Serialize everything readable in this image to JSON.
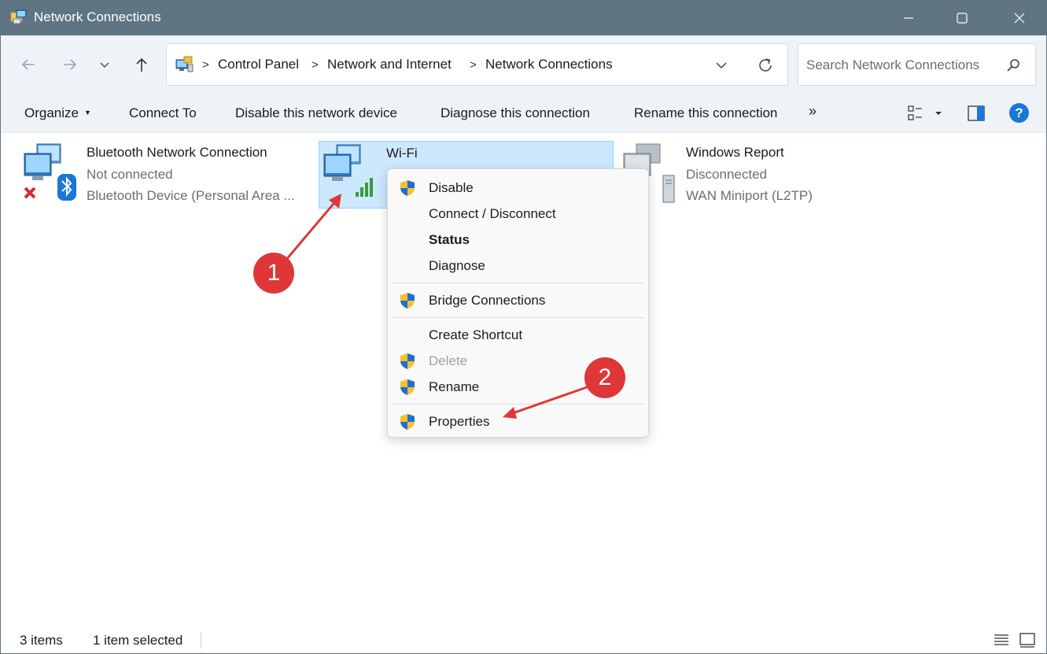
{
  "window": {
    "title": "Network Connections"
  },
  "address": {
    "crumbs": [
      "Control Panel",
      "Network and Internet",
      "Network Connections"
    ],
    "separator": ">"
  },
  "search": {
    "placeholder": "Search Network Connections"
  },
  "commandbar": {
    "organize": "Organize",
    "connect_to": "Connect To",
    "disable": "Disable this network device",
    "diagnose": "Diagnose this connection",
    "rename": "Rename this connection",
    "more": "»",
    "help": "?"
  },
  "items": [
    {
      "name": "Bluetooth Network Connection",
      "status": "Not connected",
      "device": "Bluetooth Device (Personal Area ..."
    },
    {
      "name": "Wi-Fi",
      "status": "",
      "device": ""
    },
    {
      "name": "Windows Report",
      "status": "Disconnected",
      "device": "WAN Miniport (L2TP)"
    }
  ],
  "context_menu": {
    "items": [
      {
        "label": "Disable",
        "shield": true
      },
      {
        "label": "Connect / Disconnect",
        "shield": false
      },
      {
        "label": "Status",
        "shield": false,
        "bold": true
      },
      {
        "label": "Diagnose",
        "shield": false
      },
      {
        "label": "Bridge Connections",
        "shield": true
      },
      {
        "label": "Create Shortcut",
        "shield": false
      },
      {
        "label": "Delete",
        "shield": true,
        "disabled": true
      },
      {
        "label": "Rename",
        "shield": true
      },
      {
        "label": "Properties",
        "shield": true
      }
    ]
  },
  "annotations": {
    "step1": "1",
    "step2": "2"
  },
  "statusbar": {
    "count": "3 items",
    "selected": "1 item selected"
  },
  "colors": {
    "titlebar": "#5f7583",
    "selection": "#cce8ff",
    "annotation": "#df3638",
    "help": "#1a77d6"
  }
}
